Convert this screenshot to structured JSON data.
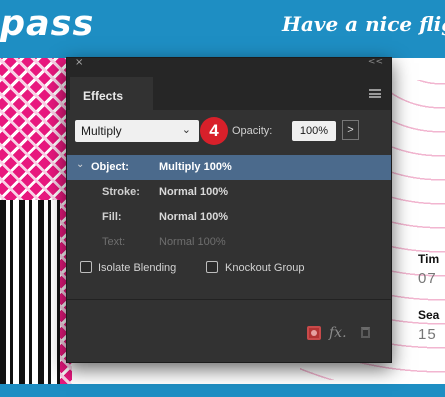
{
  "background": {
    "brand_text": "pass",
    "tagline": "Have a nice flig",
    "info": [
      {
        "label": "Tim",
        "value": "07"
      },
      {
        "label": "Sea",
        "value": "15"
      }
    ],
    "colors": {
      "blue": "#1e8ec3",
      "pink": "#e8187e"
    }
  },
  "panel": {
    "tab_label": "Effects",
    "close_glyph": "×",
    "collapse_glyph": "<<",
    "blend_mode": "Multiply",
    "step_badge": "4",
    "opacity_label": "Opacity:",
    "opacity_value": "100%",
    "rows": [
      {
        "label": "Object:",
        "value": "Multiply 100%"
      },
      {
        "label": "Stroke:",
        "value": "Normal 100%"
      },
      {
        "label": "Fill:",
        "value": "Normal 100%"
      },
      {
        "label": "Text:",
        "value": "Normal 100%"
      }
    ],
    "isolate_label": "Isolate Blending",
    "knockout_label": "Knockout Group",
    "icons": [
      "menu-icon",
      "chevron-down-icon",
      "arrow-right-icon",
      "clear-effects-icon",
      "fx-icon",
      "trash-icon"
    ],
    "colors": {
      "selected_row": "#4b6a8c",
      "badge": "#d8202a"
    }
  }
}
